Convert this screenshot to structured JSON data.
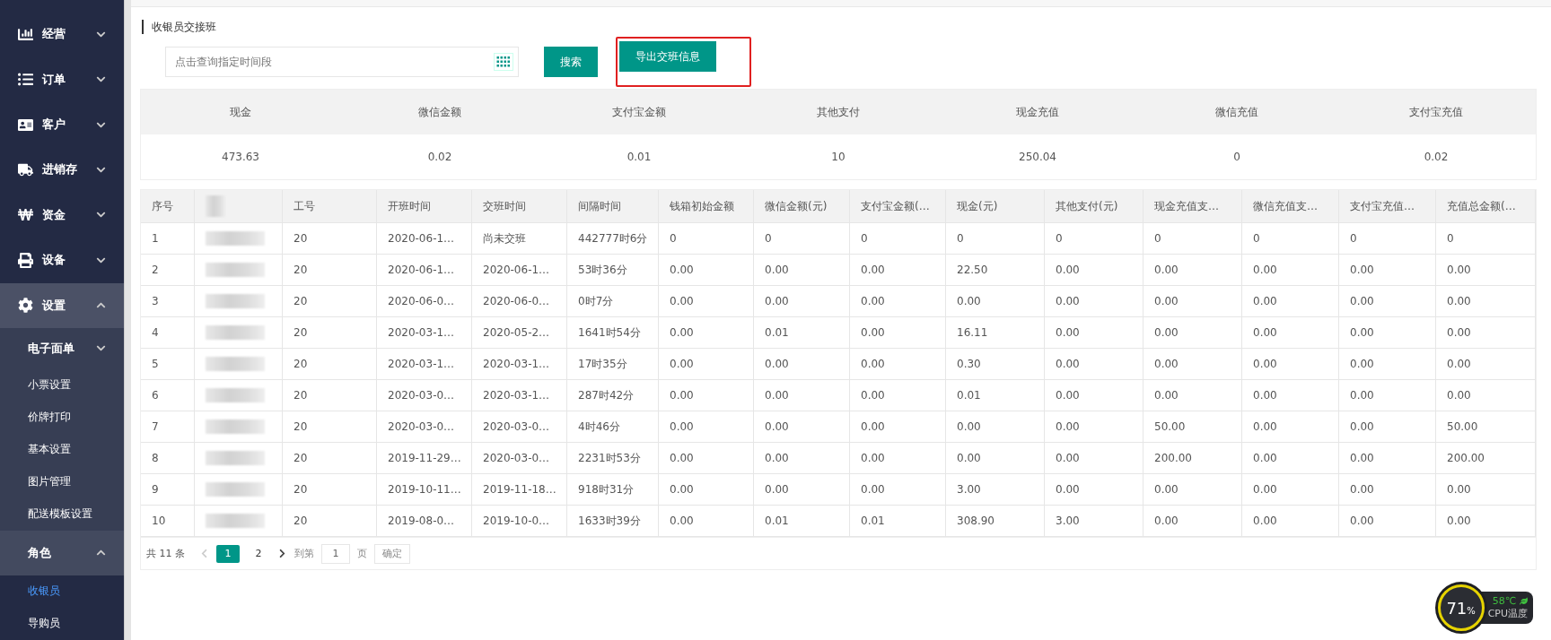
{
  "sidebar": {
    "items": [
      {
        "label": "经营",
        "expanded": false,
        "selected": false
      },
      {
        "label": "订单",
        "expanded": false,
        "selected": false
      },
      {
        "label": "客户",
        "expanded": false,
        "selected": false
      },
      {
        "label": "进销存",
        "expanded": false,
        "selected": false
      },
      {
        "label": "资金",
        "expanded": false,
        "selected": false
      },
      {
        "label": "设备",
        "expanded": false,
        "selected": false
      },
      {
        "label": "设置",
        "expanded": true,
        "selected": false,
        "children": [
          {
            "kind": "group",
            "label": "电子面单",
            "expanded": false,
            "selected": false
          },
          {
            "kind": "link",
            "label": "小票设置",
            "selected": false
          },
          {
            "kind": "link",
            "label": "价牌打印",
            "selected": false
          },
          {
            "kind": "link",
            "label": "基本设置",
            "selected": false
          },
          {
            "kind": "link",
            "label": "图片管理",
            "selected": false
          },
          {
            "kind": "link",
            "label": "配送模板设置",
            "selected": false
          },
          {
            "kind": "group",
            "label": "角色",
            "expanded": true,
            "selected": false,
            "children": [
              {
                "label": "收银员",
                "selected": true
              },
              {
                "label": "导购员",
                "selected": false
              }
            ]
          }
        ]
      }
    ]
  },
  "page_title": "收银员交接班",
  "search": {
    "placeholder": "点击查询指定时间段"
  },
  "search_button": {
    "label": "搜索"
  },
  "export_button": {
    "label": "导出交班信息",
    "highlighted": true
  },
  "summary": {
    "columns": [
      "现金",
      "微信金额",
      "支付宝金额",
      "其他支付",
      "现金充值",
      "微信充值",
      "支付宝充值"
    ],
    "values": [
      "473.63",
      "0.02",
      "0.01",
      "10",
      "250.04",
      "0",
      "0.02"
    ]
  },
  "table": {
    "columns": [
      {
        "kind": "text",
        "label": "序号"
      },
      {
        "kind": "redacted"
      },
      {
        "kind": "text",
        "label": "工号"
      },
      {
        "kind": "text",
        "label": "开班时间"
      },
      {
        "kind": "text",
        "label": "交班时间"
      },
      {
        "kind": "text",
        "label": "间隔时间"
      },
      {
        "kind": "text",
        "label": "钱箱初始金额"
      },
      {
        "kind": "text",
        "label": "微信金额(元)"
      },
      {
        "kind": "text",
        "label": "支付宝金额(…"
      },
      {
        "kind": "text",
        "label": "现金(元)"
      },
      {
        "kind": "text",
        "label": "其他支付(元)"
      },
      {
        "kind": "text",
        "label": "现金充值支…"
      },
      {
        "kind": "text",
        "label": "微信充值支…"
      },
      {
        "kind": "text",
        "label": "支付宝充值…"
      },
      {
        "kind": "text",
        "label": "充值总金额(…"
      }
    ],
    "rows": [
      [
        "1",
        "",
        "20",
        "2020-06-1…",
        "尚未交班",
        "442777时6分",
        "0",
        "0",
        "0",
        "0",
        "0",
        "0",
        "0",
        "0",
        "0"
      ],
      [
        "2",
        "",
        "20",
        "2020-06-1…",
        "2020-06-1…",
        "53时36分",
        "0.00",
        "0.00",
        "0.00",
        "22.50",
        "0.00",
        "0.00",
        "0.00",
        "0.00",
        "0.00"
      ],
      [
        "3",
        "",
        "20",
        "2020-06-0…",
        "2020-06-0…",
        "0时7分",
        "0.00",
        "0.00",
        "0.00",
        "0.00",
        "0.00",
        "0.00",
        "0.00",
        "0.00",
        "0.00"
      ],
      [
        "4",
        "",
        "20",
        "2020-03-1…",
        "2020-05-2…",
        "1641时54分",
        "0.00",
        "0.01",
        "0.00",
        "16.11",
        "0.00",
        "0.00",
        "0.00",
        "0.00",
        "0.00"
      ],
      [
        "5",
        "",
        "20",
        "2020-03-1…",
        "2020-03-1…",
        "17时35分",
        "0.00",
        "0.00",
        "0.00",
        "0.30",
        "0.00",
        "0.00",
        "0.00",
        "0.00",
        "0.00"
      ],
      [
        "6",
        "",
        "20",
        "2020-03-0…",
        "2020-03-1…",
        "287时42分",
        "0.00",
        "0.00",
        "0.00",
        "0.01",
        "0.00",
        "0.00",
        "0.00",
        "0.00",
        "0.00"
      ],
      [
        "7",
        "",
        "20",
        "2020-03-0…",
        "2020-03-0…",
        "4时46分",
        "0.00",
        "0.00",
        "0.00",
        "0.00",
        "0.00",
        "50.00",
        "0.00",
        "0.00",
        "50.00"
      ],
      [
        "8",
        "",
        "20",
        "2019-11-29…",
        "2020-03-0…",
        "2231时53分",
        "0.00",
        "0.00",
        "0.00",
        "0.00",
        "0.00",
        "200.00",
        "0.00",
        "0.00",
        "200.00"
      ],
      [
        "9",
        "",
        "20",
        "2019-10-11…",
        "2019-11-18…",
        "918时31分",
        "0.00",
        "0.00",
        "0.00",
        "3.00",
        "0.00",
        "0.00",
        "0.00",
        "0.00",
        "0.00"
      ],
      [
        "10",
        "",
        "20",
        "2019-08-0…",
        "2019-10-0…",
        "1633时39分",
        "0.00",
        "0.01",
        "0.01",
        "308.90",
        "3.00",
        "0.00",
        "0.00",
        "0.00",
        "0.00"
      ]
    ]
  },
  "pagination": {
    "total": "共 11 条",
    "pages": [
      {
        "label": "1",
        "selected": true
      },
      {
        "label": "2",
        "selected": false
      }
    ],
    "goto_label": "到第",
    "goto_value": "1",
    "page_unit": "页",
    "confirm": "确定"
  },
  "cpu_widget": {
    "usage": "71",
    "unit": "%",
    "temperature": "58℃",
    "label": "CPU温度"
  }
}
